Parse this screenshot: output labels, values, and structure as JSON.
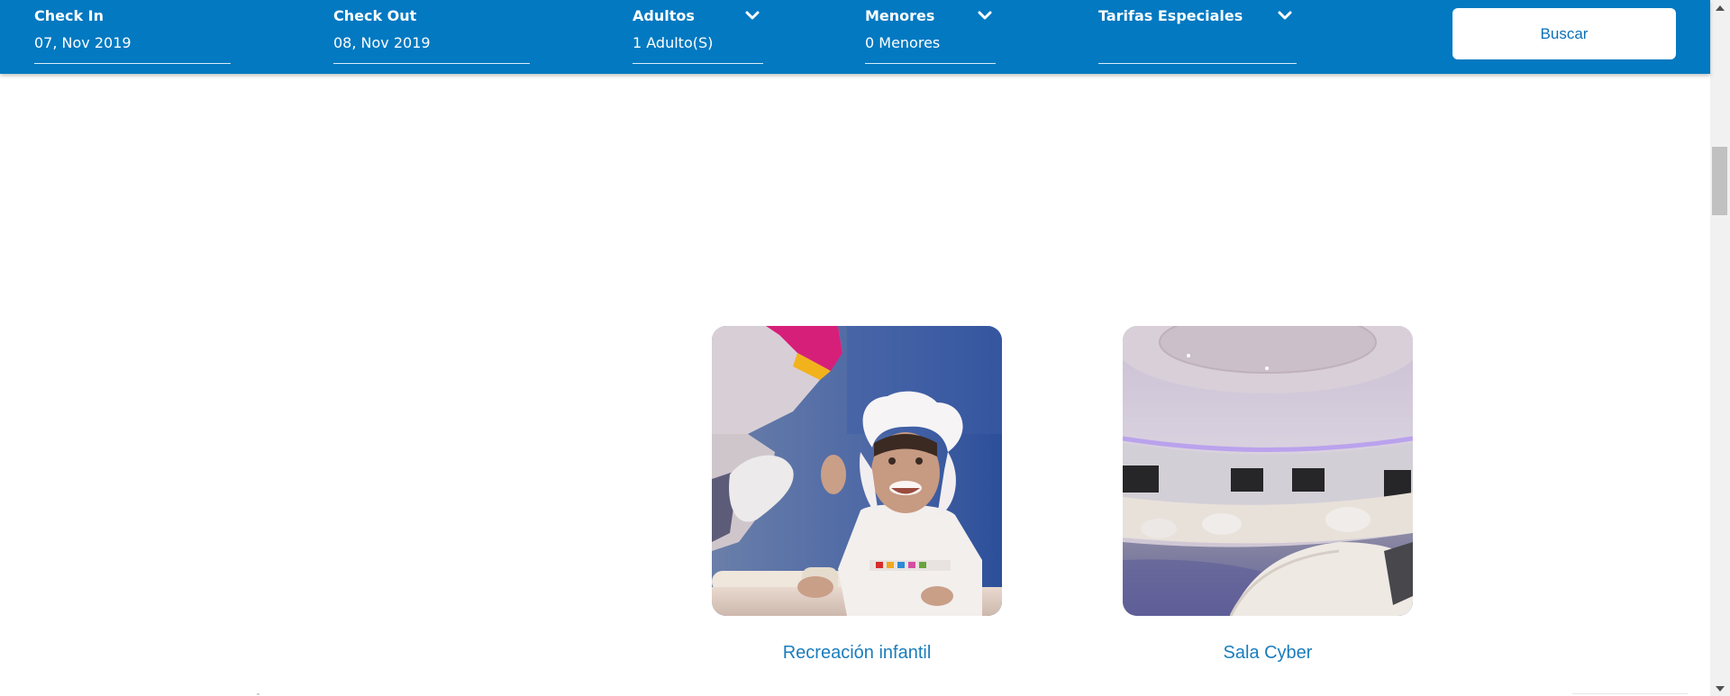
{
  "booking_bar": {
    "check_in": {
      "label": "Check In",
      "value": "07, Nov 2019"
    },
    "check_out": {
      "label": "Check Out",
      "value": "08, Nov 2019"
    },
    "adults": {
      "label": "Adultos",
      "value": "1 Adulto(S)"
    },
    "minors": {
      "label": "Menores",
      "value": "0 Menores"
    },
    "special_rates": {
      "label": "Tarifas Especiales",
      "value": ""
    },
    "search_label": "Buscar",
    "colors": {
      "bar": "#0279c1",
      "button_text": "#0a6fb7"
    }
  },
  "cards": [
    {
      "label": "Recreación infantil",
      "image": "child-baking-photo"
    },
    {
      "label": "Sala Cyber",
      "image": "cyber-room-photo"
    }
  ],
  "colors": {
    "card_label": "#1a7dbd"
  }
}
